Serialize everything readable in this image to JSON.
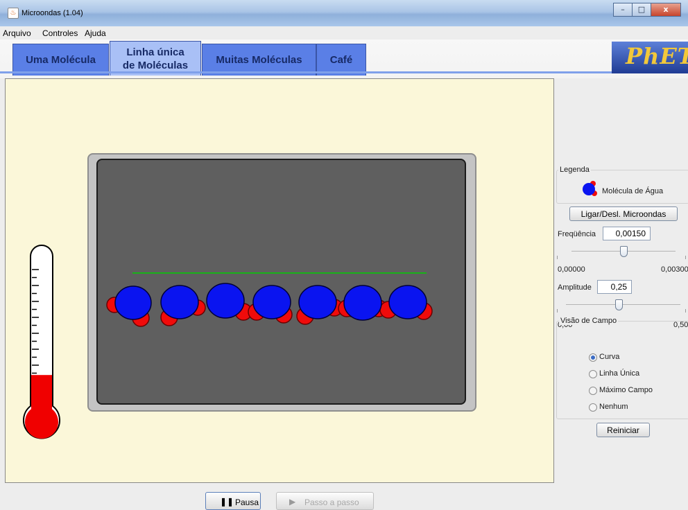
{
  "window": {
    "title": "Microondas (1.04)",
    "minimize": "–",
    "maximize": "□",
    "close": "x"
  },
  "menu": [
    "Arquivo",
    "Controles",
    "Ajuda"
  ],
  "tabs": [
    {
      "label": "Uma Molécula",
      "active": false
    },
    {
      "label": "Linha única de Moléculas",
      "active": true
    },
    {
      "label": "Muitas Moléculas",
      "active": false
    },
    {
      "label": "Café",
      "active": false
    }
  ],
  "logo": "PhET",
  "legend": {
    "title": "Legenda",
    "item": "Molécula de Água"
  },
  "controls": {
    "toggle_button": "Ligar/Desl. Microondas",
    "frequency": {
      "label": "Freqüência",
      "value": "0,00150",
      "min": "0,00000",
      "max": "0,00300",
      "level": 0.5
    },
    "amplitude": {
      "label": "Amplitude",
      "value": "0,25",
      "min": "0,00",
      "max": "0,50",
      "level": 0.5
    },
    "field_view": {
      "title": "Visão de Campo",
      "options": [
        "Curva",
        "Linha Única",
        "Máximo Campo",
        "Nenhum"
      ],
      "selected": "Curva"
    },
    "reset_button": "Reiniciar"
  },
  "playback": {
    "pause_label": "Pausa",
    "step_label": "Passo a passo"
  },
  "thermometer": {
    "level": 0.2
  },
  "colors": {
    "oxygen": "#0a14f0",
    "hydrogen": "#f00b0b",
    "field_line": "#18b218",
    "mercury": "#f00000"
  }
}
